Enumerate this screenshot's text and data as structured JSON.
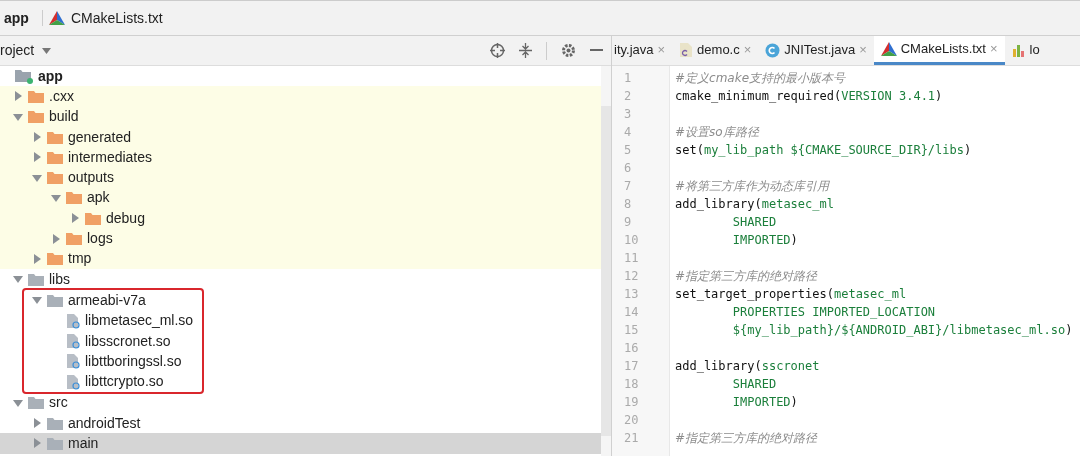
{
  "breadcrumb": [
    {
      "label": "app",
      "kind": "module"
    },
    {
      "label": "CMakeLists.txt",
      "kind": "cmake"
    }
  ],
  "project_panel": {
    "title": "roject",
    "tree": [
      {
        "label": "app",
        "kind": "module",
        "excluded": false,
        "selected": false,
        "children": [
          {
            "label": ".cxx",
            "kind": "folder",
            "expanded": false,
            "excluded": true,
            "selected": false
          },
          {
            "label": "build",
            "kind": "folder",
            "expanded": true,
            "excluded": true,
            "selected": false,
            "children": [
              {
                "label": "generated",
                "kind": "folder",
                "expanded": false,
                "excluded": true,
                "selected": false
              },
              {
                "label": "intermediates",
                "kind": "folder",
                "expanded": false,
                "excluded": true,
                "selected": false
              },
              {
                "label": "outputs",
                "kind": "folder",
                "expanded": true,
                "excluded": true,
                "selected": false,
                "children": [
                  {
                    "label": "apk",
                    "kind": "folder",
                    "expanded": true,
                    "excluded": true,
                    "selected": false,
                    "children": [
                      {
                        "label": "debug",
                        "kind": "folder",
                        "expanded": false,
                        "excluded": true,
                        "selected": false
                      }
                    ]
                  },
                  {
                    "label": "logs",
                    "kind": "folder",
                    "expanded": false,
                    "excluded": true,
                    "selected": false
                  }
                ]
              },
              {
                "label": "tmp",
                "kind": "folder",
                "expanded": false,
                "excluded": true,
                "selected": false
              }
            ]
          },
          {
            "label": "libs",
            "kind": "folder",
            "expanded": true,
            "excluded": false,
            "selected": false,
            "children": [
              {
                "label": "armeabi-v7a",
                "kind": "folder",
                "expanded": true,
                "excluded": false,
                "selected": false,
                "annotated": true,
                "children": [
                  {
                    "label": "libmetasec_ml.so",
                    "kind": "file",
                    "excluded": false,
                    "selected": false
                  },
                  {
                    "label": "libsscronet.so",
                    "kind": "file",
                    "excluded": false,
                    "selected": false
                  },
                  {
                    "label": "libttboringssl.so",
                    "kind": "file",
                    "excluded": false,
                    "selected": false
                  },
                  {
                    "label": "libttcrypto.so",
                    "kind": "file",
                    "excluded": false,
                    "selected": false
                  }
                ]
              }
            ]
          },
          {
            "label": "src",
            "kind": "folder",
            "expanded": true,
            "excluded": false,
            "selected": false,
            "children": [
              {
                "label": "androidTest",
                "kind": "folder",
                "expanded": false,
                "excluded": false,
                "selected": false
              },
              {
                "label": "main",
                "kind": "folder",
                "expanded": false,
                "excluded": false,
                "selected": true
              }
            ]
          }
        ]
      }
    ]
  },
  "tabs": [
    {
      "label": "ity.java",
      "kind": "text",
      "selected": false,
      "closable": true
    },
    {
      "label": "demo.c",
      "kind": "c",
      "selected": false,
      "closable": true
    },
    {
      "label": "JNITest.java",
      "kind": "class",
      "selected": false,
      "closable": true
    },
    {
      "label": "CMakeLists.txt",
      "kind": "cmake",
      "selected": true,
      "closable": true
    },
    {
      "label": "lo",
      "kind": "chart",
      "selected": false,
      "closable": false
    }
  ],
  "close_glyph": "×",
  "code": [
    {
      "number": "1",
      "parts": [
        {
          "kind": "comment",
          "text": "#定义cmake支持的最小版本号"
        }
      ]
    },
    {
      "number": "2",
      "parts": [
        {
          "kind": "plain",
          "text": "cmake_minimum_required("
        },
        {
          "kind": "arg",
          "text": "VERSION 3.4.1"
        },
        {
          "kind": "plain",
          "text": ")"
        }
      ]
    },
    {
      "number": "3"
    },
    {
      "number": "4",
      "parts": [
        {
          "kind": "comment",
          "text": "#设置so库路径"
        }
      ]
    },
    {
      "number": "5",
      "parts": [
        {
          "kind": "plain",
          "text": "set("
        },
        {
          "kind": "arg",
          "text": "my_lib_path ${CMAKE_SOURCE_DIR}/libs"
        },
        {
          "kind": "plain",
          "text": ")"
        }
      ]
    },
    {
      "number": "6"
    },
    {
      "number": "7",
      "parts": [
        {
          "kind": "comment",
          "text": "#将第三方库作为动态库引用"
        }
      ]
    },
    {
      "number": "8",
      "parts": [
        {
          "kind": "plain",
          "text": "add_library("
        },
        {
          "kind": "arg",
          "text": "metasec_ml"
        }
      ]
    },
    {
      "number": "9",
      "parts": [
        {
          "kind": "arg",
          "text": "        SHARED"
        }
      ]
    },
    {
      "number": "10",
      "parts": [
        {
          "kind": "arg",
          "text": "        IMPORTED"
        },
        {
          "kind": "plain",
          "text": ")"
        }
      ]
    },
    {
      "number": "11"
    },
    {
      "number": "12",
      "parts": [
        {
          "kind": "comment",
          "text": "#指定第三方库的绝对路径"
        }
      ]
    },
    {
      "number": "13",
      "parts": [
        {
          "kind": "plain",
          "text": "set_target_properties("
        },
        {
          "kind": "arg",
          "text": "metasec_ml"
        }
      ]
    },
    {
      "number": "14",
      "parts": [
        {
          "kind": "arg",
          "text": "        PROPERTIES IMPORTED_LOCATION"
        }
      ]
    },
    {
      "number": "15",
      "parts": [
        {
          "kind": "arg",
          "text": "        ${my_lib_path}/${ANDROID_ABI}/libmetasec_ml.so"
        },
        {
          "kind": "plain",
          "text": ")"
        }
      ]
    },
    {
      "number": "16"
    },
    {
      "number": "17",
      "parts": [
        {
          "kind": "plain",
          "text": "add_library("
        },
        {
          "kind": "arg",
          "text": "sscronet"
        }
      ]
    },
    {
      "number": "18",
      "parts": [
        {
          "kind": "arg",
          "text": "        SHARED"
        }
      ]
    },
    {
      "number": "19",
      "parts": [
        {
          "kind": "arg",
          "text": "        IMPORTED"
        },
        {
          "kind": "plain",
          "text": ")"
        }
      ]
    },
    {
      "number": "20"
    },
    {
      "number": "21",
      "parts": [
        {
          "kind": "comment",
          "text": "#指定第三方库的绝对路径"
        }
      ]
    }
  ]
}
